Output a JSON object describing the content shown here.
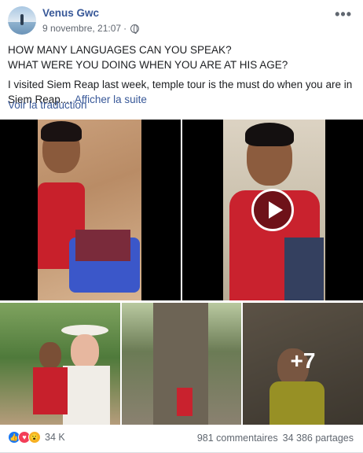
{
  "post": {
    "author": "Venus Gwc",
    "timestamp": "9 novembre, 21:07",
    "separator": "·",
    "audience_icon": "globe-icon",
    "menu_icon": "more-options-icon",
    "text": {
      "line1": "HOW MANY LANGUAGES CAN YOU SPEAK?",
      "line2": "WHAT WERE YOU DOING WHEN YOU ARE AT HIS AGE?",
      "line3": "I visited Siem Reap last week, temple tour is the must do when you are in",
      "line4": "Siem Reap....",
      "see_more": "Afficher la suite"
    },
    "translate": "Voir la traduction"
  },
  "media": {
    "extra_count": "+7"
  },
  "footer": {
    "reactions_count": "34 K",
    "comments": "981 commentaires",
    "shares": "34 386 partages"
  },
  "colors": {
    "link": "#385898",
    "like": "#1877f2",
    "love": "#f33e58",
    "wow": "#f7b125"
  }
}
